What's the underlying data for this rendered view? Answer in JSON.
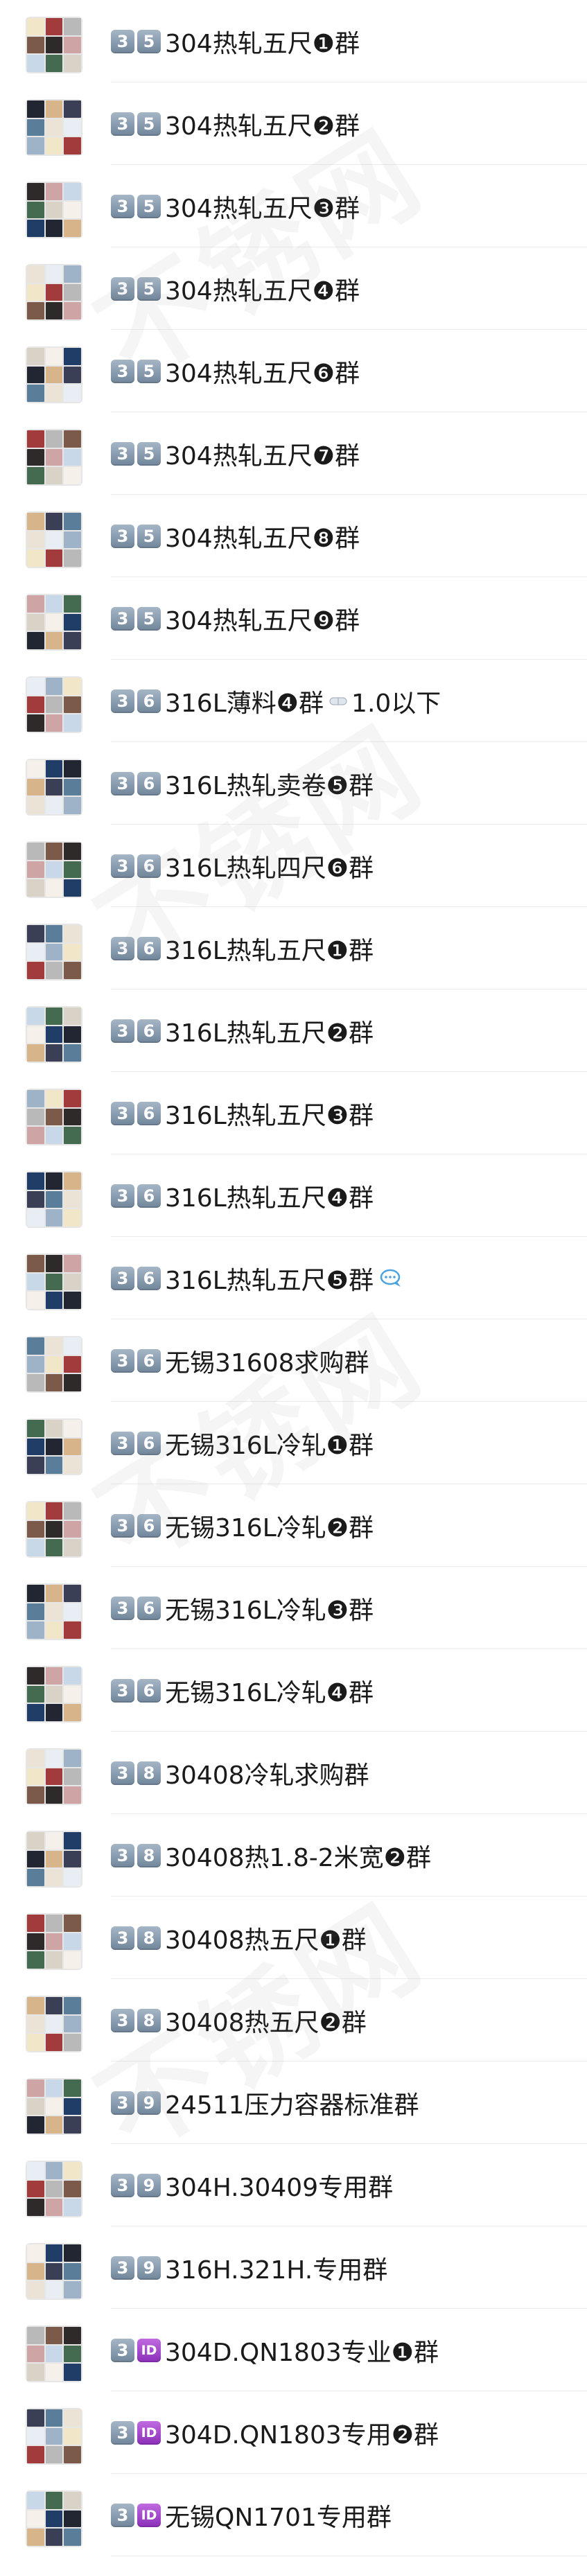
{
  "groups": [
    {
      "badges": [
        "3",
        "5"
      ],
      "badge_style": "blue",
      "title": "304热轧五尺❶群"
    },
    {
      "badges": [
        "3",
        "5"
      ],
      "badge_style": "blue",
      "title": "304热轧五尺❷群"
    },
    {
      "badges": [
        "3",
        "5"
      ],
      "badge_style": "blue",
      "title": "304热轧五尺❸群"
    },
    {
      "badges": [
        "3",
        "5"
      ],
      "badge_style": "blue",
      "title": "304热轧五尺❹群"
    },
    {
      "badges": [
        "3",
        "5"
      ],
      "badge_style": "blue",
      "title": "304热轧五尺❻群"
    },
    {
      "badges": [
        "3",
        "5"
      ],
      "badge_style": "blue",
      "title": "304热轧五尺❼群"
    },
    {
      "badges": [
        "3",
        "5"
      ],
      "badge_style": "blue",
      "title": "304热轧五尺❽群"
    },
    {
      "badges": [
        "3",
        "5"
      ],
      "badge_style": "blue",
      "title": "304热轧五尺❾群"
    },
    {
      "badges": [
        "3",
        "6"
      ],
      "badge_style": "blue",
      "title": "316L薄料❹群",
      "suffix_icon": "pill-icon",
      "suffix_text": "1.0以下"
    },
    {
      "badges": [
        "3",
        "6"
      ],
      "badge_style": "blue",
      "title": "316L热轧卖卷❺群"
    },
    {
      "badges": [
        "3",
        "6"
      ],
      "badge_style": "blue",
      "title": "316L热轧四尺❻群"
    },
    {
      "badges": [
        "3",
        "6"
      ],
      "badge_style": "blue",
      "title": "316L热轧五尺❶群"
    },
    {
      "badges": [
        "3",
        "6"
      ],
      "badge_style": "blue",
      "title": "316L热轧五尺❷群"
    },
    {
      "badges": [
        "3",
        "6"
      ],
      "badge_style": "blue",
      "title": "316L热轧五尺❸群"
    },
    {
      "badges": [
        "3",
        "6"
      ],
      "badge_style": "blue",
      "title": "316L热轧五尺❹群"
    },
    {
      "badges": [
        "3",
        "6"
      ],
      "badge_style": "blue",
      "title": "316L热轧五尺❺群",
      "suffix_icon": "chat-bubble-icon"
    },
    {
      "badges": [
        "3",
        "6"
      ],
      "badge_style": "blue",
      "title": "无锡31608求购群"
    },
    {
      "badges": [
        "3",
        "6"
      ],
      "badge_style": "blue",
      "title": "无锡316L冷轧❶群"
    },
    {
      "badges": [
        "3",
        "6"
      ],
      "badge_style": "blue",
      "title": "无锡316L冷轧❷群"
    },
    {
      "badges": [
        "3",
        "6"
      ],
      "badge_style": "blue",
      "title": "无锡316L冷轧❸群"
    },
    {
      "badges": [
        "3",
        "6"
      ],
      "badge_style": "blue",
      "title": "无锡316L冷轧❹群"
    },
    {
      "badges": [
        "3",
        "8"
      ],
      "badge_style": "blue",
      "title": "30408冷轧求购群"
    },
    {
      "badges": [
        "3",
        "8"
      ],
      "badge_style": "blue",
      "title": "30408热1.8-2米宽❷群"
    },
    {
      "badges": [
        "3",
        "8"
      ],
      "badge_style": "blue",
      "title": "30408热五尺❶群"
    },
    {
      "badges": [
        "3",
        "8"
      ],
      "badge_style": "blue",
      "title": "30408热五尺❷群"
    },
    {
      "badges": [
        "3",
        "9"
      ],
      "badge_style": "blue",
      "title": "24511压力容器标准群"
    },
    {
      "badges": [
        "3",
        "9"
      ],
      "badge_style": "blue",
      "title": "304H.30409专用群"
    },
    {
      "badges": [
        "3",
        "9"
      ],
      "badge_style": "blue",
      "title": "316H.321H.专用群"
    },
    {
      "badges": [
        "3",
        "ID"
      ],
      "badge_style": "purple",
      "title": "304D.QN1803专业❶群"
    },
    {
      "badges": [
        "3",
        "ID"
      ],
      "badge_style": "purple",
      "title": "304D.QN1803专用❷群"
    },
    {
      "badges": [
        "3",
        "ID"
      ],
      "badge_style": "purple",
      "title": "无锡QN1701专用群"
    }
  ],
  "watermark": {
    "text": "不锈网"
  },
  "colors": {
    "badge_blue": "#8598ab",
    "badge_purple": "#a447cf",
    "divider": "#ececec",
    "title": "#1a1a1a"
  }
}
